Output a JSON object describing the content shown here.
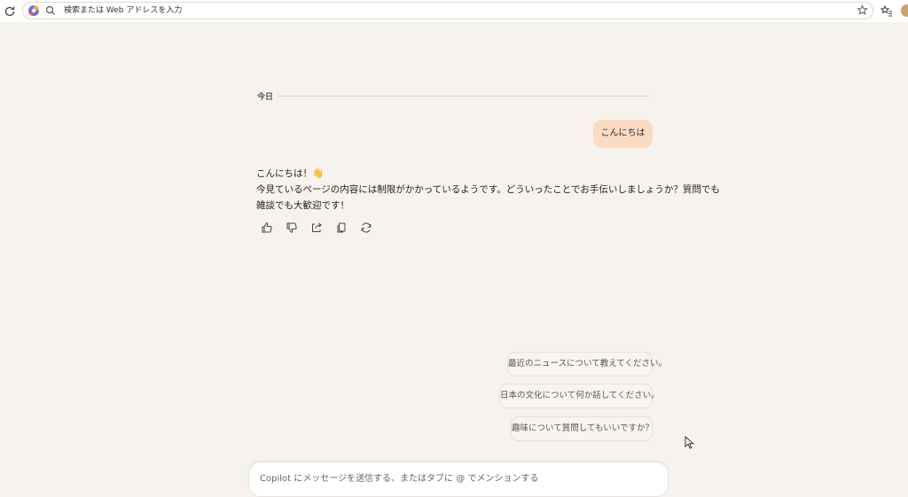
{
  "browser": {
    "address_placeholder": "検索または Web アドレスを入力"
  },
  "chat": {
    "date_divider": "今日",
    "user_message": "こんにちは",
    "reply_lines": [
      "こんにちは！👋",
      "今見ているページの内容には制限がかかっているようです。どういったことでお手伝いしましょうか？質問でも",
      "雑談でも大歓迎です！"
    ],
    "actions": [
      "thumbs-up",
      "thumbs-down",
      "share",
      "copy",
      "regenerate"
    ]
  },
  "suggestions": [
    "最近のニュースについて教えてください。",
    "日本の文化について何か話してください。",
    "趣味について質問してもいいですか？"
  ],
  "composer": {
    "placeholder": "Copilot にメッセージを送信する、またはタブに @ でメンションする"
  },
  "colors": {
    "background": "#f6f3ef",
    "user_bubble": "#fbdcc2",
    "accent": "#2b2b2b"
  }
}
